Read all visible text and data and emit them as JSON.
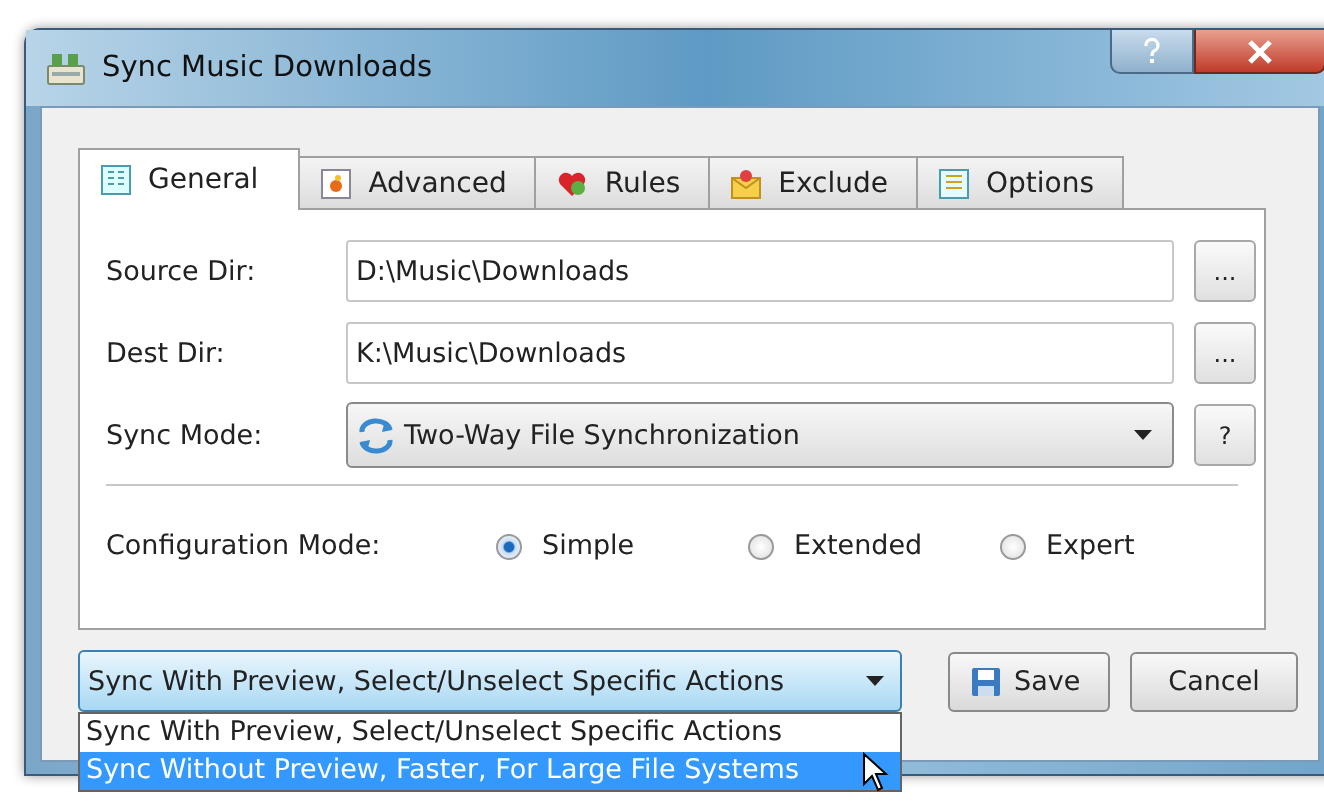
{
  "window": {
    "title": "Sync Music Downloads"
  },
  "tabs": [
    {
      "label": "General",
      "selected": true
    },
    {
      "label": "Advanced",
      "selected": false
    },
    {
      "label": "Rules",
      "selected": false
    },
    {
      "label": "Exclude",
      "selected": false
    },
    {
      "label": "Options",
      "selected": false
    }
  ],
  "fields": [
    {
      "kind": "path",
      "label": "Source Dir:",
      "value": "D:\\Music\\Downloads",
      "button": "..."
    },
    {
      "kind": "path",
      "label": "Dest Dir:",
      "value": "K:\\Music\\Downloads",
      "button": "..."
    },
    {
      "kind": "select",
      "label": "Sync Mode:",
      "value": "Two-Way File Synchronization",
      "button": "?"
    }
  ],
  "configuration_mode": {
    "label": "Configuration Mode:",
    "options": [
      {
        "label": "Simple",
        "selected": true
      },
      {
        "label": "Extended",
        "selected": false
      },
      {
        "label": "Expert",
        "selected": false
      }
    ]
  },
  "sync_action": {
    "value": "Sync With Preview, Select/Unselect Specific Actions",
    "expanded": true,
    "options": [
      {
        "label": "Sync With Preview, Select/Unselect Specific Actions",
        "highlighted": false
      },
      {
        "label": "Sync Without Preview, Faster, For Large File Systems",
        "highlighted": true
      }
    ]
  },
  "buttons": [
    {
      "kind": "save",
      "label": "Save"
    },
    {
      "kind": "cancel",
      "label": "Cancel"
    }
  ]
}
